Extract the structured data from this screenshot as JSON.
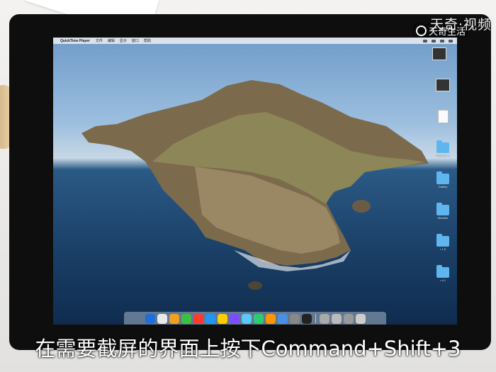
{
  "menubar": {
    "apple_glyph": "",
    "app_name": "QuickTime Player",
    "menus": [
      "文件",
      "编辑",
      "显示",
      "窗口",
      "帮助"
    ]
  },
  "desktop": {
    "icons": [
      {
        "label": "",
        "kind": "screenshot"
      },
      {
        "label": "",
        "kind": "screenshot"
      },
      {
        "label": "",
        "kind": "document"
      },
      {
        "label": "Weather 2",
        "kind": "folder"
      },
      {
        "label": "Gallery",
        "kind": "folder"
      },
      {
        "label": "Weather",
        "kind": "folder"
      },
      {
        "label": "• 1.5",
        "kind": "folder"
      },
      {
        "label": "• 4.1",
        "kind": "folder"
      }
    ]
  },
  "dock": {
    "colors": [
      "#1e6fd9",
      "#e8e8e8",
      "#f0a020",
      "#3fbf3f",
      "#ff3b30",
      "#2196f3",
      "#ffcc00",
      "#7c4dff",
      "#5ac8fa",
      "#2ecc71",
      "#ff9500",
      "#4a90e2",
      "#888888",
      "#222222",
      "#aaaaaa",
      "#bbbbbb",
      "#999999",
      "#cccccc"
    ]
  },
  "watermark": {
    "brand": "天奇·视频",
    "tag": "天奇生活"
  },
  "caption": "在需要截屏的界面上按下Command+Shift+3",
  "colors": {
    "folder": "#5fb6ee",
    "sea": "#1a3f66",
    "sky": "#8fb4d8"
  }
}
